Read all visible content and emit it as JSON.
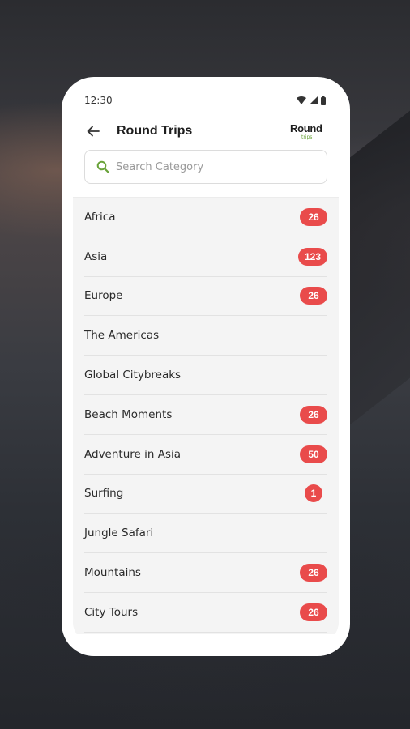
{
  "status_bar": {
    "time": "12:30"
  },
  "header": {
    "title": "Round Trips",
    "logo_main": "Round",
    "logo_sub": "trips"
  },
  "search": {
    "placeholder": "Search Category"
  },
  "categories": [
    {
      "label": "Africa",
      "count": "26"
    },
    {
      "label": "Asia",
      "count": "123"
    },
    {
      "label": "Europe",
      "count": "26"
    },
    {
      "label": "The Americas",
      "count": ""
    },
    {
      "label": "Global Citybreaks",
      "count": ""
    },
    {
      "label": "Beach Moments",
      "count": "26"
    },
    {
      "label": "Adventure in Asia",
      "count": "50"
    },
    {
      "label": "Surfing",
      "count": "1"
    },
    {
      "label": "Jungle Safari",
      "count": ""
    },
    {
      "label": "Mountains",
      "count": "26"
    },
    {
      "label": "City Tours",
      "count": "26"
    }
  ],
  "colors": {
    "badge": "#e94b4b",
    "search_icon": "#6aa33a",
    "logo_accent": "#6aa33a"
  }
}
